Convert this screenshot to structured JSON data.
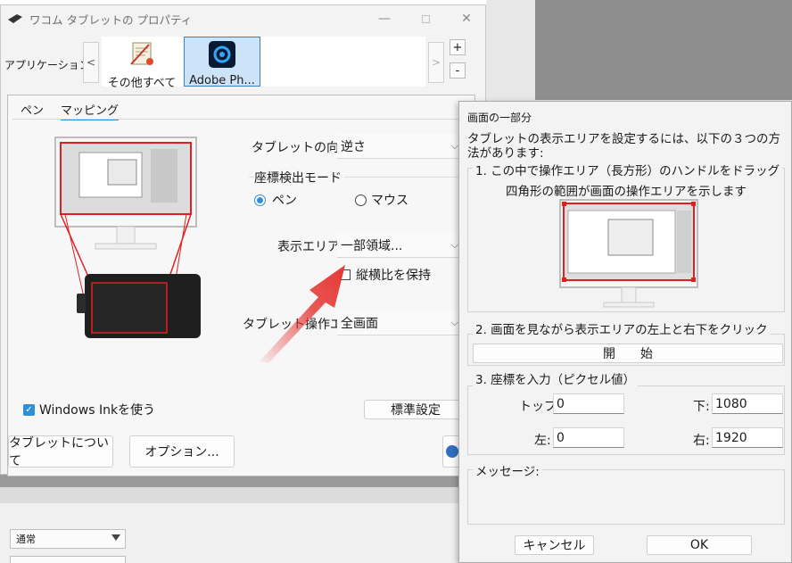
{
  "window": {
    "title": "ワコム タブレットの プロパティ",
    "app_label": "アプリケーション:",
    "apps": [
      {
        "label": "その他すべて",
        "icon": "all-apps-icon"
      },
      {
        "label": "Adobe Ph...",
        "icon": "photoshop-icon"
      }
    ],
    "tabs": [
      "ペン",
      "マッピング"
    ]
  },
  "mapping": {
    "orientation_label": "タブレットの向き:",
    "orientation_value": "逆さ",
    "mode_group_label": "座標検出モード",
    "mode_pen": "ペン",
    "mode_mouse": "マウス",
    "display_area_label": "表示エリア:",
    "display_area_value": "一部領域...",
    "keep_aspect_label": "縦横比を保持",
    "tablet_area_label": "タブレット操作エリ",
    "tablet_area_value": "全画面",
    "windows_ink_label": "Windows Inkを使う",
    "default_button": "標準設定"
  },
  "footer": {
    "about_button": "タブレットについて",
    "options_button": "オプション..."
  },
  "bottom_dropdown": "通常",
  "dialog": {
    "title": "画面の一部分",
    "intro": "タブレットの表示エリアを設定するには、以下の３つの方法があります:",
    "method1_title": "1. この中で操作エリア（長方形）のハンドルをドラッグ",
    "method1_desc": "四角形の範囲が画面の操作エリアを示します",
    "method2_title": "2. 画面を見ながら表示エリアの左上と右下をクリック",
    "start_button": "開　　始",
    "method3_title": "3. 座標を入力（ピクセル値）",
    "top_label": "トップ:",
    "top_value": "0",
    "bottom_label": "下:",
    "bottom_value": "1080",
    "left_label": "左:",
    "left_value": "0",
    "right_label": "右:",
    "right_value": "1920",
    "message_label": "メッセージ:",
    "cancel_button": "キャンセル",
    "ok_button": "OK"
  },
  "colors": {
    "accent": "#2f8fd9",
    "mapping_red": "#e02020",
    "arrow_red": "#e53935"
  }
}
